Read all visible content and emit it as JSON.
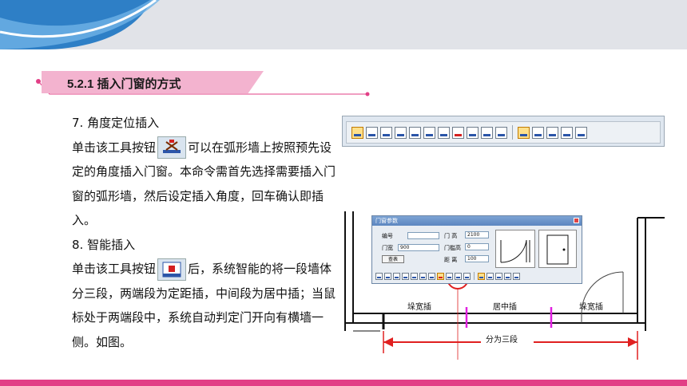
{
  "header": {
    "section_title": "5.2.1 插入门窗的方式",
    "accent_color": "#e23f86",
    "title_bar_color": "#f3b3cf"
  },
  "content": {
    "item7_heading": "7. 角度定位插入",
    "item7_text_before_icon": "单击该工具按钮",
    "item7_text_after_icon": "可以在弧形墙上按照预先设定的角度插入门窗。本命令需首先选择需要插入门窗的弧形墙，然后设定插入角度，回车确认即插入。",
    "item8_heading": "8. 智能插入",
    "item8_text_before_icon": "单击该工具按钮",
    "item8_text_after_icon": "后，系统智能的将一段墙体分三段，两端段为定距插，中间段为居中插；当鼠标处于两端段中，系统自动判定门开向有横墙一侧。如图。"
  },
  "icons": {
    "angle_insert": "angle-insert-icon",
    "smart_insert": "smart-insert-icon"
  },
  "dialog": {
    "title": "门窗参数",
    "label_number": "编号",
    "label_door_width": "门宽",
    "door_width_value": "900",
    "label_door_height": "门 高",
    "door_height_value": "2100",
    "label_sill_height": "门槛高",
    "sill_height_value": "0",
    "label_distance": "距 离",
    "distance_value": "100",
    "lookup_button": "查表"
  },
  "diagram": {
    "label_left": "垛宽插",
    "label_middle": "居中插",
    "label_right": "垛宽插",
    "dimension_label": "分为三段"
  }
}
